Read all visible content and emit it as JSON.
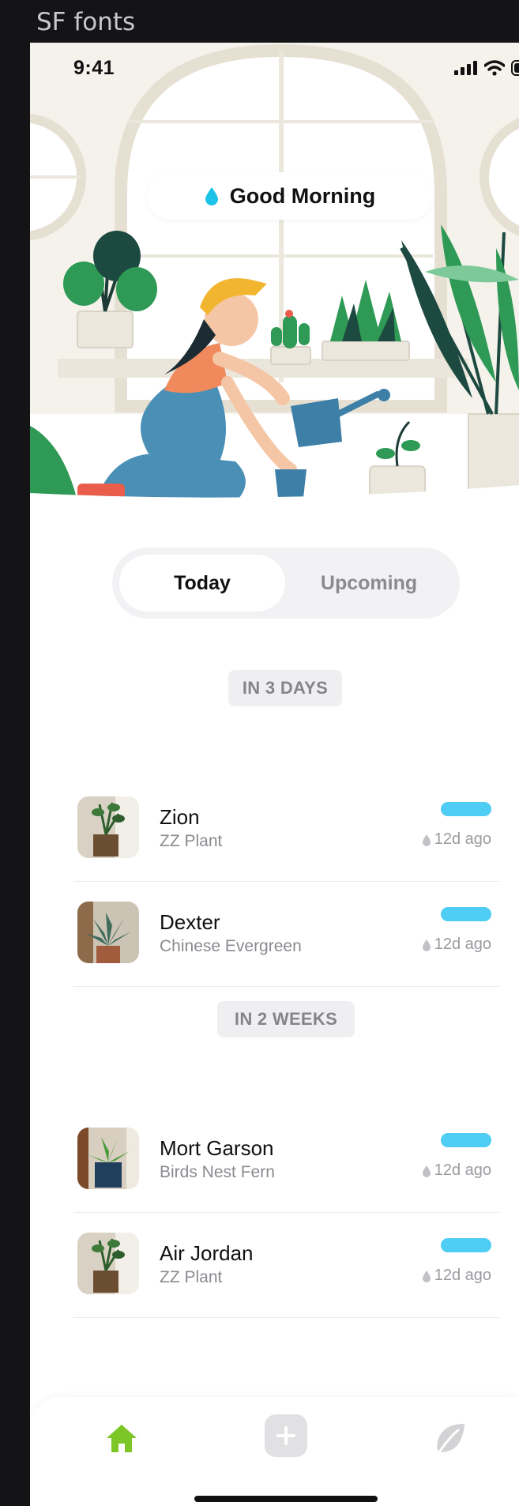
{
  "frame_label": "SF fonts",
  "status_bar": {
    "time": "9:41"
  },
  "greeting": {
    "text": "Good Morning",
    "icon": "water-drop-icon"
  },
  "segmented": {
    "today": "Today",
    "upcoming": "Upcoming",
    "selected": "Today"
  },
  "colors": {
    "accent_bar": "#4fcdf5",
    "home_active": "#7cc627",
    "greeting_drop": "#1cc3e6"
  },
  "sections": [
    {
      "label": "IN 3 DAYS",
      "plants": [
        {
          "name": "Zion",
          "species": "ZZ Plant",
          "ago": "12d ago"
        },
        {
          "name": "Dexter",
          "species": "Chinese Evergreen",
          "ago": "12d ago"
        }
      ]
    },
    {
      "label": "IN 2 WEEKS",
      "plants": [
        {
          "name": "Mort Garson",
          "species": "Birds Nest Fern",
          "ago": "12d ago"
        },
        {
          "name": "Air Jordan",
          "species": "ZZ Plant",
          "ago": "12d ago"
        }
      ]
    }
  ],
  "tabbar": {
    "home": "home-icon",
    "add": "plus-icon",
    "plants": "leaf-icon"
  }
}
